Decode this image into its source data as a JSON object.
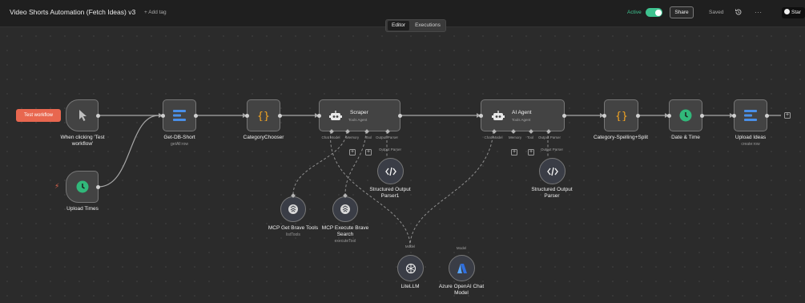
{
  "header": {
    "title": "Video Shorts Automation (Fetch Ideas) v3",
    "add_tag": "+ Add tag",
    "active_label": "Active",
    "share_label": "Share",
    "saved_label": "Saved",
    "star_label": "Star",
    "more_label": "···"
  },
  "tabs": {
    "editor": "Editor",
    "executions": "Executions"
  },
  "canvas": {
    "test_workflow": "Test workflow",
    "nodes": {
      "manual_trigger": {
        "label": "When clicking 'Test\nworkflow'"
      },
      "upload_times": {
        "label": "Upload Times"
      },
      "get_db_short": {
        "label": "Get-DB-Short",
        "sub": "getAll:row"
      },
      "category_chooser": {
        "label": "CategoryChooser"
      },
      "scraper": {
        "title": "Scraper",
        "subtitle": "Tools Agent",
        "p1": "Chat Model",
        "p2": "Memory",
        "p3": "Tool",
        "p4": "Output Parser"
      },
      "ai_agent": {
        "title": "AI Agent",
        "subtitle": "Tools Agent",
        "p1": "Chat Model",
        "p2": "Memory",
        "p3": "Tool",
        "p4": "Output Parser"
      },
      "category_split": {
        "label": "Category-Spelling+Split"
      },
      "date_time": {
        "label": "Date & Time"
      },
      "upload_ideas": {
        "label": "Upload Ideas",
        "sub": "create:row"
      },
      "parser1": {
        "top": "Output Parser",
        "label": "Structured Output\nParser1"
      },
      "parser2": {
        "top": "Output Parser",
        "label": "Structured Output\nParser"
      },
      "mcp_get": {
        "label": "MCP Get Brave Tools",
        "sub": "listTools"
      },
      "mcp_exec": {
        "label": "MCP Execute Brave\nSearch",
        "sub": "executeTool"
      },
      "litellm": {
        "top": "Model",
        "label": "LiteLLM"
      },
      "azure": {
        "top": "Model",
        "label": "Azure OpenAI Chat\nModel"
      }
    }
  },
  "colors": {
    "accent_green": "#3ec28f",
    "test_button": "#e8674f",
    "db_blue": "#4a8fe7",
    "code_orange": "#f5a623",
    "time_green": "#31b87a",
    "azure_blue": "#2f6fe0"
  }
}
